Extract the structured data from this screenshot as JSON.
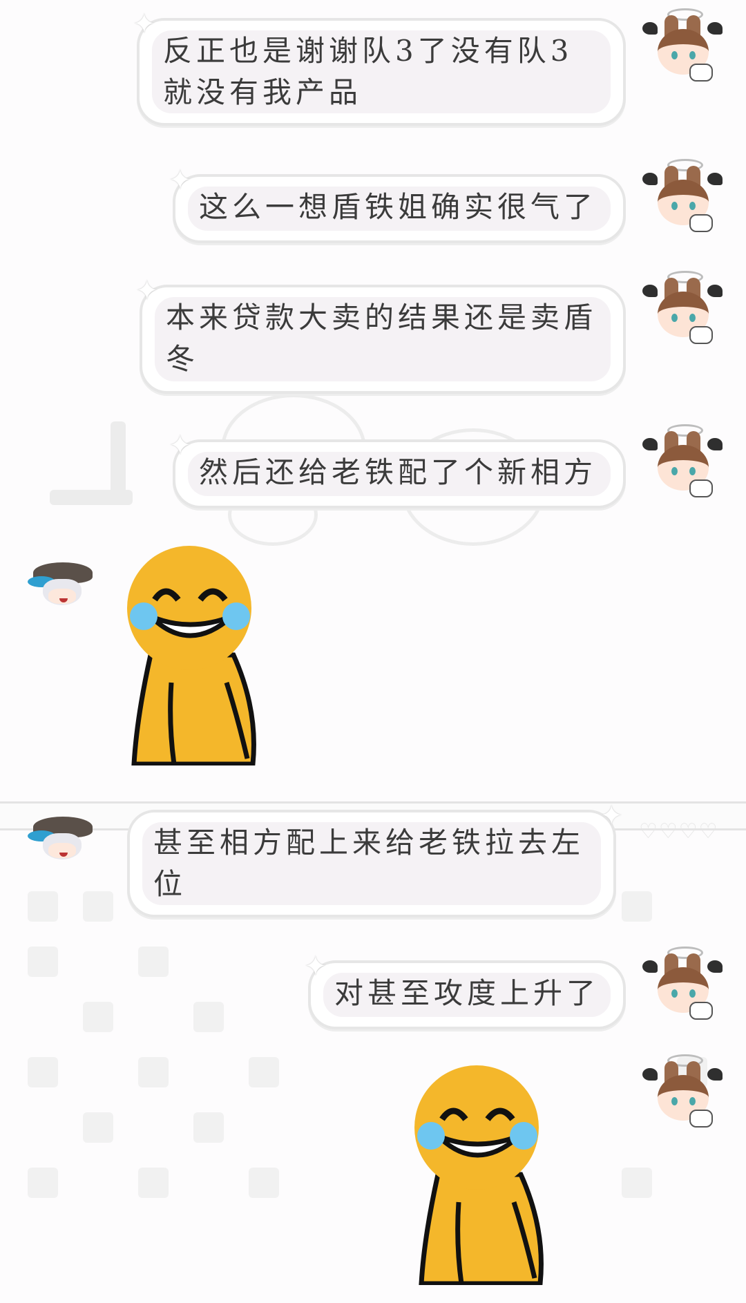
{
  "messages": [
    {
      "side": "right",
      "text": "反正也是谢谢队3了没有队3就没有我产品"
    },
    {
      "side": "right",
      "text": "这么一想盾铁姐确实很气了"
    },
    {
      "side": "right",
      "text": "本来贷款大卖的结果还是卖盾冬"
    },
    {
      "side": "right",
      "text": "然后还给老铁配了个新相方"
    },
    {
      "side": "left",
      "sticker": "laughing-crying-emoji"
    },
    {
      "side": "left",
      "text": "甚至相方配上来给老铁拉去左位"
    },
    {
      "side": "right",
      "text": "对甚至攻度上升了"
    },
    {
      "side": "right",
      "sticker": "laughing-crying-emoji"
    }
  ],
  "colors": {
    "bubble_border": "#e6e6e6",
    "bubble_fill": "#f5f2f5",
    "emoji": "#f4b72b",
    "tear": "#6ec6f0"
  },
  "icons": {
    "sparkle": "✦",
    "hearts": "♡♡♡♡"
  }
}
